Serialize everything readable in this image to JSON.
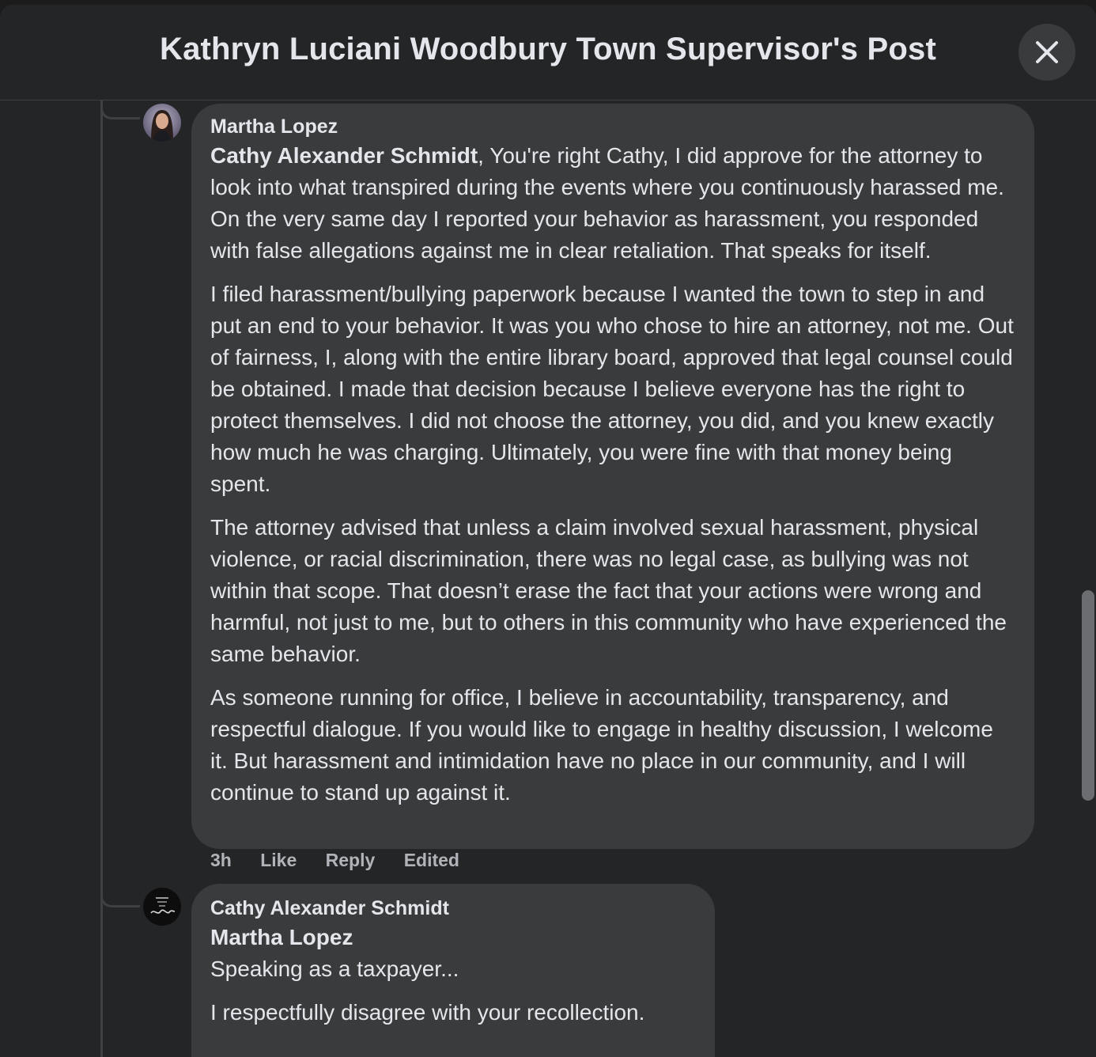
{
  "modal": {
    "title": "Kathryn Luciani Woodbury Town Supervisor's Post"
  },
  "comments": [
    {
      "author": "Martha Lopez",
      "mention": "Cathy Alexander Schmidt",
      "paragraphs": [
        ", You're right Cathy, I did approve for the attorney to look into what transpired during the events where you continuously harassed me. On the very same day I reported your behavior as harassment, you responded with false allegations against me in clear retaliation. That speaks for itself.",
        "I filed harassment/bullying paperwork because I wanted the town to step in and put an end to your behavior. It was you who chose to hire an attorney, not me. Out of fairness, I, along with the entire library board, approved that legal counsel could be obtained. I made that decision because I believe everyone has the right to protect themselves. I did not choose the attorney, you did, and you knew exactly how much he was charging. Ultimately, you were fine with that money being spent.",
        "The attorney advised that unless a claim involved sexual harassment, physical violence, or racial discrimination, there was no legal case, as bullying was not within that scope. That doesn’t erase the fact that your actions were wrong and harmful, not just to me, but to others in this community who have experienced the same behavior.",
        "As someone running for office, I believe in accountability, transparency, and respectful dialogue. If you would like to engage in healthy discussion, I welcome it. But harassment and intimidation have no place in our community, and I will continue to stand up against it."
      ],
      "time": "3h",
      "like_label": "Like",
      "reply_label": "Reply",
      "edited_label": "Edited"
    },
    {
      "author": "Cathy Alexander Schmidt",
      "mention": "Martha Lopez",
      "paragraphs": [
        "Speaking as a taxpayer...",
        "I respectfully disagree with your recollection."
      ]
    }
  ],
  "icons": {
    "close": "close-icon",
    "avatar1": "avatar-martha-lopez",
    "avatar2": "avatar-cathy-alexander-schmidt"
  },
  "colors": {
    "modal_bg": "#242526",
    "bubble_bg": "#3a3b3c",
    "text_primary": "#e4e6eb",
    "text_secondary": "#b0b3b8"
  }
}
